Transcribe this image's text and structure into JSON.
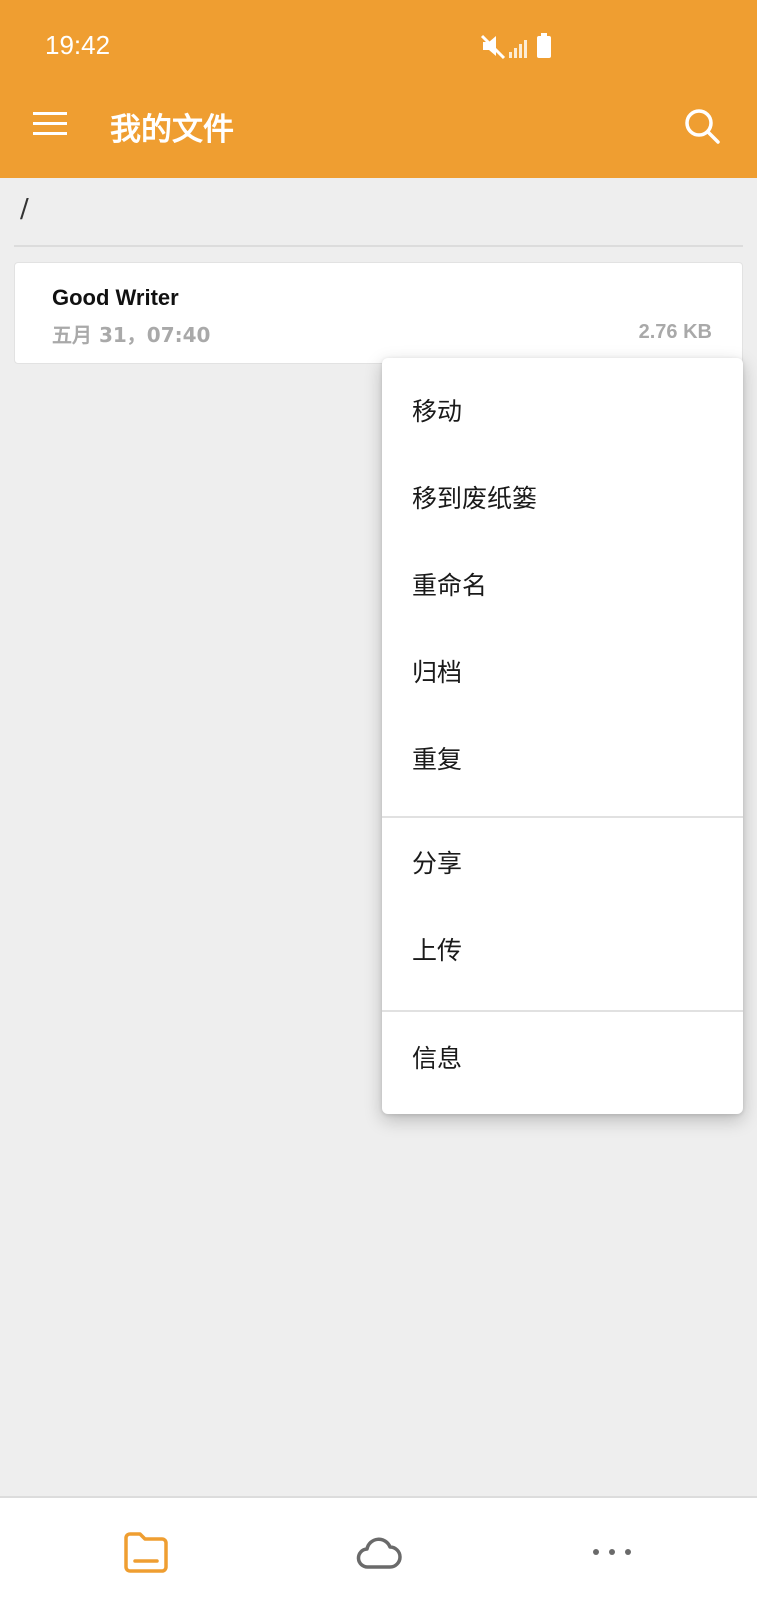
{
  "status_bar": {
    "time": "19:42"
  },
  "app_bar": {
    "title": "我的文件"
  },
  "breadcrumb": "/",
  "file": {
    "name": "Good Writer",
    "date": "五月 31，07:40",
    "size": "2.76 KB"
  },
  "context_menu": {
    "groups": [
      [
        "移动",
        "移到废纸篓",
        "重命名",
        "归档",
        "重复"
      ],
      [
        "分享",
        "上传"
      ],
      [
        "信息"
      ]
    ]
  },
  "bottom_nav": [
    "folder-icon",
    "cloud-icon",
    "more-icon"
  ],
  "colors": {
    "accent": "#ef9e31",
    "background": "#eeeeee"
  }
}
